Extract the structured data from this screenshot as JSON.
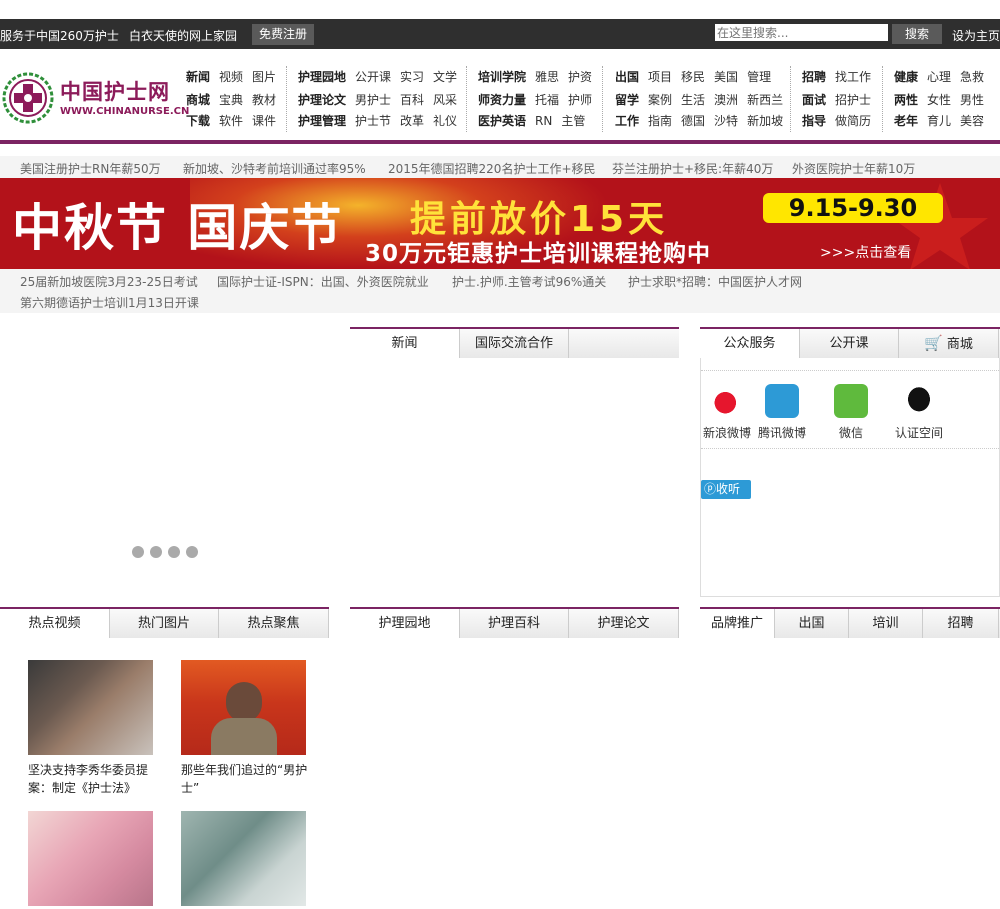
{
  "topbar": {
    "slogan1": "服务于中国260万护士",
    "slogan2": "白衣天使的网上家园",
    "register": "免费注册",
    "search_placeholder": "在这里搜索...",
    "search_button": "搜索",
    "set_home": "设为主页"
  },
  "logo": {
    "cn": "中国护士网",
    "en": "WWW.CHINANURSE.CN"
  },
  "nav": [
    [
      [
        "新闻",
        "视频",
        "图片"
      ],
      [
        "商城",
        "宝典",
        "教材"
      ],
      [
        "下载",
        "软件",
        "课件"
      ]
    ],
    [
      [
        "护理园地",
        "公开课",
        "实习",
        "文学"
      ],
      [
        "护理论文",
        "男护士",
        "百科",
        "风采"
      ],
      [
        "护理管理",
        "护士节",
        "改革",
        "礼仪"
      ]
    ],
    [
      [
        "培训学院",
        "雅思",
        "护资"
      ],
      [
        "师资力量",
        "托福",
        "护师"
      ],
      [
        "医护英语",
        "RN",
        "主管"
      ]
    ],
    [
      [
        "出国",
        "项目",
        "移民",
        "美国",
        "管理"
      ],
      [
        "留学",
        "案例",
        "生活",
        "澳洲",
        "新西兰"
      ],
      [
        "工作",
        "指南",
        "德国",
        "沙特",
        "新加坡"
      ]
    ],
    [
      [
        "招聘",
        "找工作"
      ],
      [
        "面试",
        "招护士"
      ],
      [
        "指导",
        "做简历"
      ]
    ],
    [
      [
        "健康",
        "心理",
        "急救"
      ],
      [
        "两性",
        "女性",
        "男性"
      ],
      [
        "老年",
        "育儿",
        "美容"
      ]
    ]
  ],
  "ticker1": [
    "美国注册护士RN年薪50万",
    "新加坡、沙特考前培训通过率95%",
    "2015年德国招聘220名护士工作+移民",
    "芬兰注册护士+移民:年薪40万",
    "外资医院护士年薪10万"
  ],
  "banner": {
    "left": "中秋节 国庆节",
    "headline": "提前放价15天",
    "dates": "9.15-9.30",
    "sub": "30万元钜惠护士培训课程抢购中",
    "link": ">>>点击查看"
  },
  "ticker2": [
    "25届新加坡医院3月23-25日考试",
    "国际护士证-ISPN：出国、外资医院就业",
    "护士.护师.主管考试96%通关",
    "护士求职*招聘：中国医护人才网"
  ],
  "ticker3": [
    "第六期德语护士培训1月13日开课"
  ],
  "tabs_mid_top": [
    "新闻",
    "国际交流合作"
  ],
  "tabs_right_top": [
    "公众服务",
    "公开课",
    "商城"
  ],
  "services": [
    "新浪微博",
    "腾讯微博",
    "微信",
    "认证空间"
  ],
  "listen": "收听",
  "tabs_left_bottom": [
    "热点视频",
    "热门图片",
    "热点聚焦"
  ],
  "tabs_mid_bottom": [
    "护理园地",
    "护理百科",
    "护理论文"
  ],
  "tabs_right_bottom": [
    "品牌推广",
    "出国",
    "培训",
    "招聘"
  ],
  "thumbs": [
    "坚决支持李秀华委员提案：制定《护士法》",
    "那些年我们追过的“男护士”",
    "",
    ""
  ]
}
